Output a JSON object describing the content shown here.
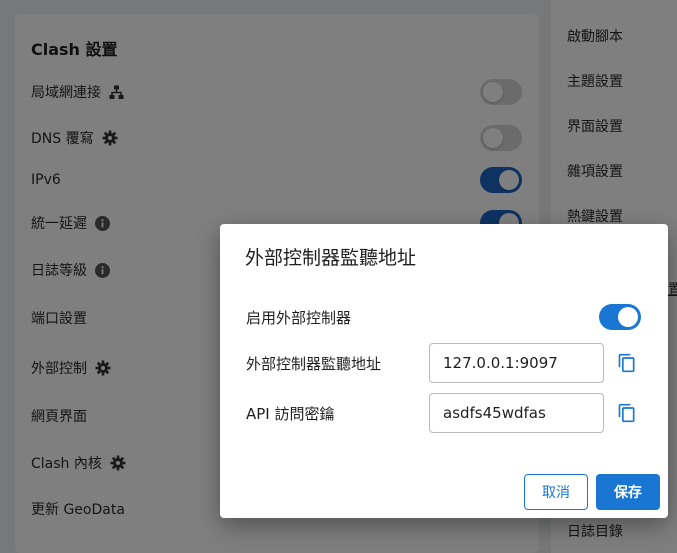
{
  "card": {
    "title": "Clash 設置",
    "rows": [
      {
        "label": "局域網連接",
        "icon": "network-icon",
        "toggle": "off"
      },
      {
        "label": "DNS 覆寫",
        "icon": "gear-icon",
        "toggle": "off"
      },
      {
        "label": "IPv6",
        "icon": "",
        "toggle": "on"
      },
      {
        "label": "統一延遲",
        "icon": "info-icon",
        "toggle": "on"
      },
      {
        "label": "日誌等級",
        "icon": "info-icon"
      },
      {
        "label": "端口設置",
        "icon": ""
      },
      {
        "label": "外部控制",
        "icon": "gear-icon"
      },
      {
        "label": "網頁界面",
        "icon": ""
      },
      {
        "label": "Clash 內核",
        "icon": "gear-icon"
      },
      {
        "label": "更新 GeoData",
        "icon": ""
      }
    ]
  },
  "side": {
    "items": [
      "啟動腳本",
      "主題設置",
      "界面設置",
      "雜項設置",
      "熱鍵設置",
      "置",
      "日誌目錄"
    ]
  },
  "dialog": {
    "title": "外部控制器監聽地址",
    "enable_label": "启用外部控制器",
    "enable_state": "on",
    "addr_label": "外部控制器監聽地址",
    "addr_value": "127.0.0.1:9097",
    "secret_label": "API 訪問密鑰",
    "secret_value": "asdfs45wdfas",
    "cancel_label": "取消",
    "save_label": "保存"
  },
  "colors": {
    "accent": "#1976d2",
    "toggle_on": "#1d64c4",
    "toggle_off": "#d7d7d7",
    "overlay": "rgba(0,0,0,0.5)"
  }
}
